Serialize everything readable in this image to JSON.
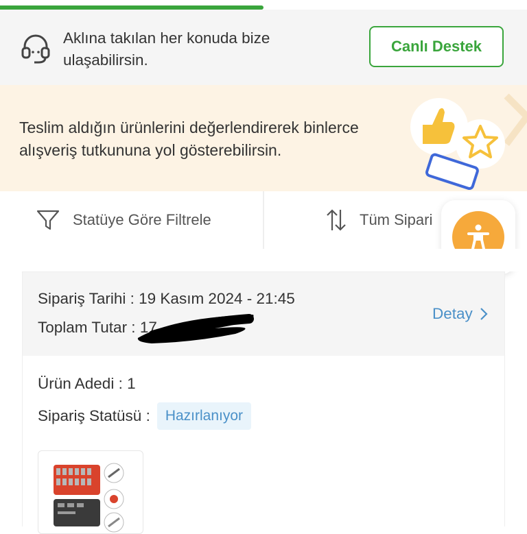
{
  "support": {
    "text": "Aklına takılan her konuda bize ulaşabilirsin.",
    "button_label": "Canlı Destek",
    "accent_color": "#3aa53c"
  },
  "review_banner": {
    "text": "Teslim aldığın ürünlerini değerlendirerek binlerce alışveriş tutkununa yol gösterebilirsin.",
    "background_color": "#fdf3e4"
  },
  "filters": {
    "status_label": "Statüye Göre Filtrele",
    "sort_label": "Tüm Sipari"
  },
  "accessibility_button": {
    "icon": "accessibility-icon",
    "color": "#f6a93b"
  },
  "order": {
    "date_line": "Sipariş Tarihi : 19 Kasım 2024 - 21:45",
    "total_label": "Toplam Tutar :",
    "total_visible": "17",
    "detail_label": "Detay",
    "item_count": "Ürün Adedi : 1",
    "status_label": "Sipariş Statüsü :",
    "status_value": "Hazırlanıyor"
  }
}
